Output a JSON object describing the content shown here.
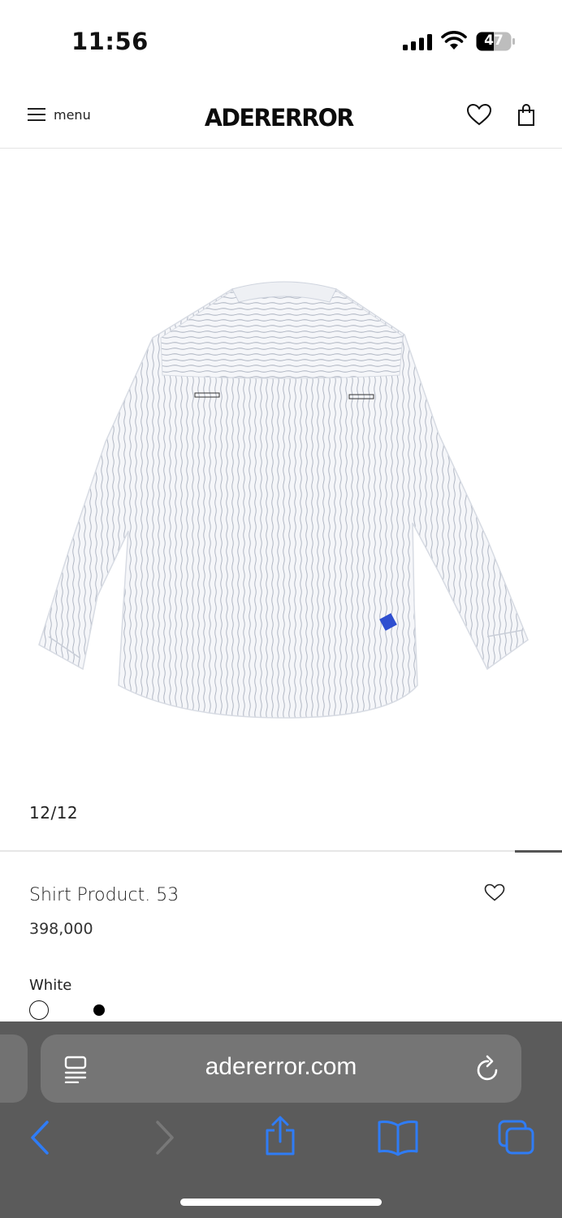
{
  "status_bar": {
    "time": "11:56",
    "battery_level": "47"
  },
  "header": {
    "menu_label": "menu",
    "brand": "ADERERROR"
  },
  "gallery": {
    "counter": "12/12",
    "current_index": 12,
    "total": 12
  },
  "product": {
    "name": "Shirt Product. 53",
    "price": "398,000",
    "selected_color": "White",
    "color_options": [
      "#ffffff",
      "#000000"
    ]
  },
  "browser": {
    "url": "adererror.com"
  },
  "icons": {
    "menu": "hamburger-icon",
    "wishlist": "heart-icon",
    "bag": "shopping-bag-icon",
    "reader": "reader-icon",
    "reload": "reload-icon",
    "back": "chevron-left-icon",
    "forward": "chevron-right-icon",
    "share": "share-icon",
    "bookmarks": "book-icon",
    "tabs": "tabs-icon"
  },
  "colors": {
    "safari_accent": "#2f7cf6",
    "safari_bar": "#5b5b5b",
    "shirt_label": "#2f4fd0"
  }
}
